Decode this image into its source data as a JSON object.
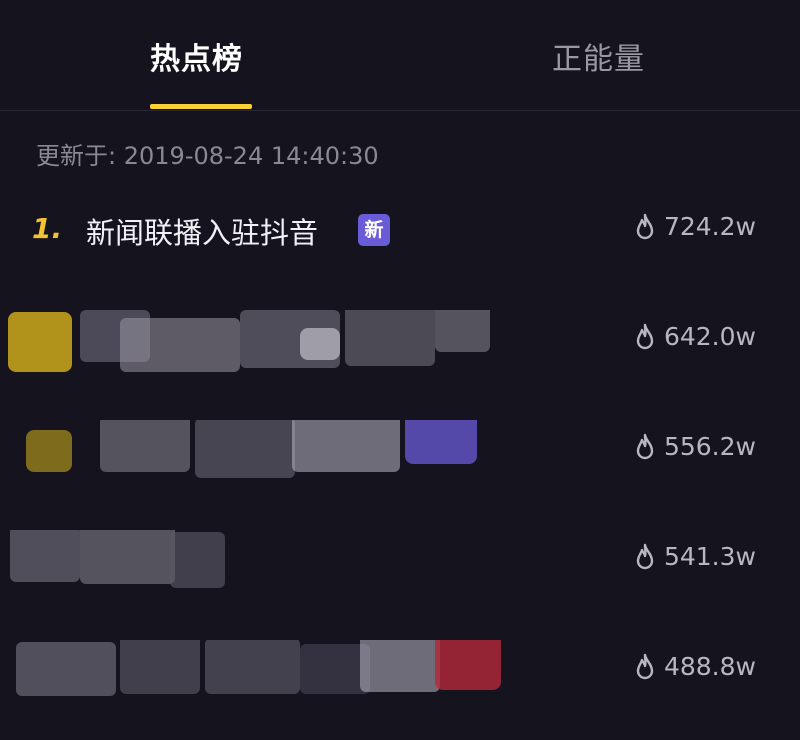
{
  "tabs": [
    {
      "label": "热点榜",
      "active": true
    },
    {
      "label": "正能量",
      "active": false
    }
  ],
  "updated": {
    "prefix": "更新于:",
    "timestamp": "2019-08-24 14:40:30"
  },
  "list": [
    {
      "rank": "1.",
      "title": "新闻联播入驻抖音",
      "badge": "新",
      "heat": "724.2w"
    },
    {
      "heat": "642.0w"
    },
    {
      "heat": "556.2w"
    },
    {
      "heat": "541.3w"
    },
    {
      "heat": "488.8w"
    }
  ],
  "colors": {
    "background": "#15131e",
    "accent": "#fbd233",
    "rank": "#f2c230",
    "badge": "#6a5cd8"
  }
}
